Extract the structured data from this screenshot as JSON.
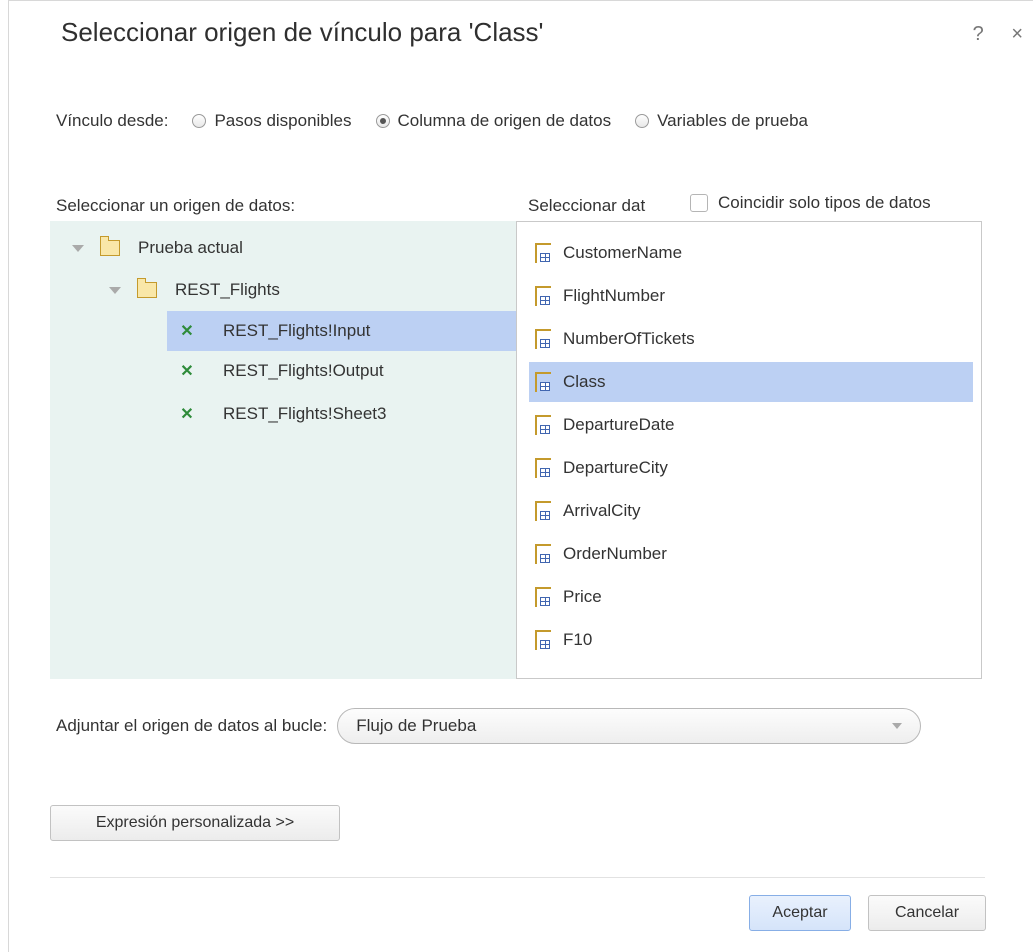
{
  "dialog": {
    "title": "Seleccionar origen de vínculo para 'Class'",
    "help": "?",
    "close": "×"
  },
  "link_from": {
    "label": "Vínculo desde:",
    "options": [
      {
        "label": "Pasos disponibles",
        "selected": false
      },
      {
        "label": "Columna de origen de datos",
        "selected": true
      },
      {
        "label": "Variables de prueba",
        "selected": false
      }
    ]
  },
  "source_pane": {
    "label": "Seleccionar un origen de datos:",
    "tree": [
      {
        "label": "Prueba actual",
        "type": "folder",
        "level": 0,
        "expanded": true
      },
      {
        "label": "REST_Flights",
        "type": "folder",
        "level": 1,
        "expanded": true
      },
      {
        "label": "REST_Flights!Input",
        "type": "sheet",
        "level": 2,
        "selected": true
      },
      {
        "label": "REST_Flights!Output",
        "type": "sheet",
        "level": 2,
        "selected": false
      },
      {
        "label": "REST_Flights!Sheet3",
        "type": "sheet",
        "level": 2,
        "selected": false
      }
    ]
  },
  "data_pane": {
    "label": "Seleccionar dat",
    "match_label": "Coincidir solo tipos de datos",
    "match_checked": false,
    "fields": [
      {
        "label": "CustomerName",
        "selected": false
      },
      {
        "label": "FlightNumber",
        "selected": false
      },
      {
        "label": "NumberOfTickets",
        "selected": false
      },
      {
        "label": "Class",
        "selected": true
      },
      {
        "label": "DepartureDate",
        "selected": false
      },
      {
        "label": "DepartureCity",
        "selected": false
      },
      {
        "label": "ArrivalCity",
        "selected": false
      },
      {
        "label": "OrderNumber",
        "selected": false
      },
      {
        "label": "Price",
        "selected": false
      },
      {
        "label": "F10",
        "selected": false
      }
    ]
  },
  "attach": {
    "label": "Adjuntar el origen de datos al bucle:",
    "value": "Flujo de Prueba"
  },
  "buttons": {
    "custom": "Expresión personalizada >>",
    "ok": "Aceptar",
    "cancel": "Cancelar"
  },
  "colors": {
    "selection": "#bcd0f3",
    "tree_background": "#e9f3f1",
    "excel_icon": "#2e8b3a"
  }
}
